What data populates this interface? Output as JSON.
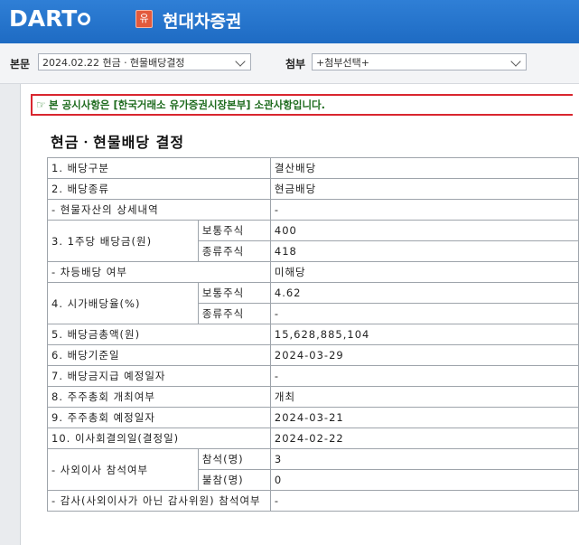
{
  "header": {
    "logo_text": "DART",
    "market_badge": "유",
    "company_name": "현대차증권"
  },
  "toolbar": {
    "main_label": "본문",
    "main_select": "2024.02.22  현금ㆍ현물배당결정",
    "attach_label": "첨부",
    "attach_select": "+첨부선택+"
  },
  "notice": {
    "icon": "pointing-hand-icon",
    "text": "본 공시사항은 [한국거래소 유가증권시장본부] 소관사항입니다."
  },
  "title": "현금ㆍ현물배당 결정",
  "table": {
    "r1": {
      "label": "1. 배당구분",
      "value": "결산배당"
    },
    "r2": {
      "label": "2. 배당종류",
      "value": "현금배당"
    },
    "r3": {
      "label": "- 현물자산의 상세내역",
      "value": "-"
    },
    "r4": {
      "label": "3. 1주당 배당금(원)",
      "sub1": "보통주식",
      "val1": "400",
      "sub2": "종류주식",
      "val2": "418"
    },
    "r5": {
      "label": "- 차등배당 여부",
      "value": "미해당"
    },
    "r6": {
      "label": "4. 시가배당율(%)",
      "sub1": "보통주식",
      "val1": "4.62",
      "sub2": "종류주식",
      "val2": "-"
    },
    "r7": {
      "label": "5. 배당금총액(원)",
      "value": "15,628,885,104"
    },
    "r8": {
      "label": "6. 배당기준일",
      "value": "2024-03-29"
    },
    "r9": {
      "label": "7. 배당금지급 예정일자",
      "value": "-"
    },
    "r10": {
      "label": "8. 주주총회 개최여부",
      "value": "개최"
    },
    "r11": {
      "label": "9. 주주총회 예정일자",
      "value": "2024-03-21"
    },
    "r12": {
      "label": "10. 이사회결의일(결정일)",
      "value": "2024-02-22"
    },
    "r13": {
      "label": "- 사외이사 참석여부",
      "sub1": "참석(명)",
      "val1": "3",
      "sub2": "불참(명)",
      "val2": "0"
    },
    "r14": {
      "label": "- 감사(사외이사가 아닌 감사위원) 참석여부",
      "value": "-"
    }
  }
}
